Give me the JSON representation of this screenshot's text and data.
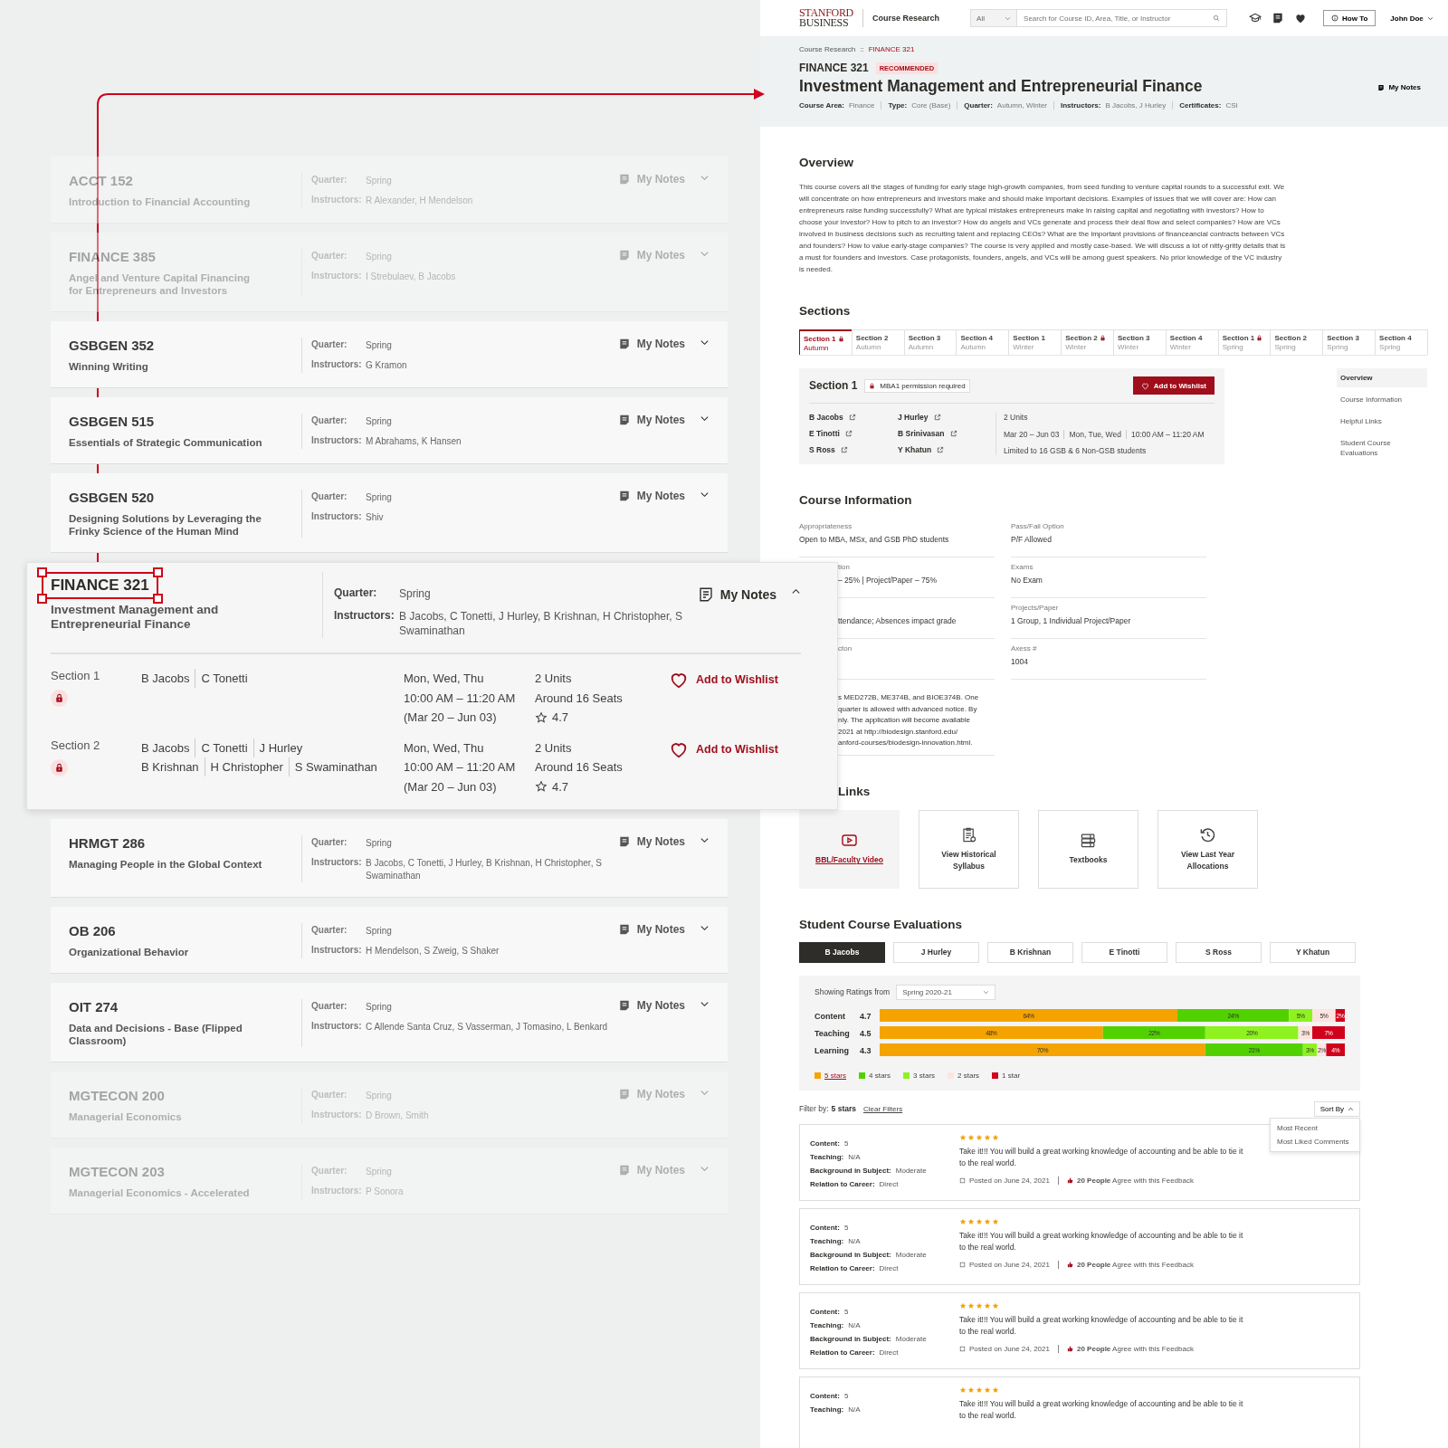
{
  "course_list": [
    {
      "code": "ACCT 152",
      "title": "Introduction to Financial Accounting",
      "quarter_label": "Quarter:",
      "quarter": "Spring",
      "instructors_label": "Instructors:",
      "instructors": "R Alexander, H Mendelson",
      "notes": "My Notes",
      "dimmed": true,
      "expanded": false
    },
    {
      "code": "FINANCE 385",
      "title": "Angel and Venture Capital Financing for Entrepreneurs and Investors",
      "quarter_label": "Quarter:",
      "quarter": "Spring",
      "instructors_label": "Instructors:",
      "instructors": "I Strebulaev, B Jacobs",
      "notes": "My Notes",
      "dimmed": true,
      "expanded": false
    },
    {
      "code": "GSBGEN 352",
      "title": "Winning Writing",
      "quarter_label": "Quarter:",
      "quarter": "Spring",
      "instructors_label": "Instructors:",
      "instructors": "G Kramon",
      "notes": "My Notes",
      "dimmed": false,
      "expanded": false
    },
    {
      "code": "GSBGEN 515",
      "title": "Essentials of Strategic Communication",
      "quarter_label": "Quarter:",
      "quarter": "Spring",
      "instructors_label": "Instructors:",
      "instructors": "M Abrahams, K Hansen",
      "notes": "My Notes",
      "dimmed": false,
      "expanded": false
    },
    {
      "code": "GSBGEN 520",
      "title": "Designing Solutions by Leveraging the Frinky Science of the Human Mind",
      "quarter_label": "Quarter:",
      "quarter": "Spring",
      "instructors_label": "Instructors:",
      "instructors": "Shiv",
      "notes": "My Notes",
      "dimmed": false,
      "expanded": false
    },
    {
      "code": "FINANCE 321",
      "title": "Investment Management and Entrepreneurial Finance",
      "quarter_label": "Quarter:",
      "quarter": "Spring",
      "instructors_label": "Instructors:",
      "instructors": "B Jacobs, C Tonetti, J Hurley, B Krishnan,  H Christopher, S Swaminathan",
      "notes": "My Notes",
      "dimmed": false,
      "expanded": true,
      "sections": [
        {
          "name": "Section 1",
          "locked": true,
          "instructor_lines": [
            [
              "B Jacobs",
              "C Tonetti"
            ]
          ],
          "schedule": [
            "Mon, Wed, Thu",
            "10:00 AM – 11:20 AM",
            "(Mar 20 – Jun 03)"
          ],
          "units": "2 Units",
          "seats": "Around 16 Seats",
          "rating": "4.7",
          "wishlist": "Add to Wishlist"
        },
        {
          "name": "Section 2",
          "locked": true,
          "instructor_lines": [
            [
              "B Jacobs",
              "C Tonetti",
              "J Hurley"
            ],
            [
              "B Krishnan",
              "H Christopher",
              "S Swaminathan"
            ]
          ],
          "schedule": [
            "Mon, Wed, Thu",
            "10:00 AM – 11:20 AM",
            "(Mar 20 – Jun 03)"
          ],
          "units": "2 Units",
          "seats": "Around 16 Seats",
          "rating": "4.7",
          "wishlist": "Add to Wishlist"
        }
      ]
    },
    {
      "code": "HRMGT 286",
      "title": "Managing People in the Global Context",
      "quarter_label": "Quarter:",
      "quarter": "Spring",
      "instructors_label": "Instructors:",
      "instructors": "B Jacobs, C Tonetti, J Hurley, B Krishnan,  H Christopher, S Swaminathan",
      "notes": "My Notes",
      "dimmed": false,
      "expanded": false
    },
    {
      "code": "OB 206",
      "title": "Organizational Behavior",
      "quarter_label": "Quarter:",
      "quarter": "Spring",
      "instructors_label": "Instructors:",
      "instructors": "H Mendelson, S Zweig, S Shaker",
      "notes": "My Notes",
      "dimmed": false,
      "expanded": false
    },
    {
      "code": "OIT 274",
      "title": "Data and Decisions - Base (Flipped Classroom)",
      "quarter_label": "Quarter:",
      "quarter": "Spring",
      "instructors_label": "Instructors:",
      "instructors": "C Allende Santa Cruz, S Vasserman, J Tomasino, L Benkard",
      "notes": "My Notes",
      "dimmed": false,
      "expanded": false
    },
    {
      "code": "MGTECON 200",
      "title": "Managerial Economics",
      "quarter_label": "Quarter:",
      "quarter": "Spring",
      "instructors_label": "Instructors:",
      "instructors": "D Brown, Smith",
      "notes": "My Notes",
      "dimmed": true,
      "expanded": false
    },
    {
      "code": "MGTECON 203",
      "title": "Managerial Economics - Accelerated",
      "quarter_label": "Quarter:",
      "quarter": "Spring",
      "instructors_label": "Instructors:",
      "instructors": "P Sonora",
      "notes": "My Notes",
      "dimmed": true,
      "expanded": false
    }
  ],
  "header": {
    "logo_top": "STANFORD",
    "logo_bottom": "BUSINESS",
    "app_name": "Course Research",
    "search_scope": "All",
    "search_placeholder": "Search for Course ID, Area, Title, or Instructor",
    "how_to": "How To",
    "user": "John Doe"
  },
  "breadcrumb": {
    "items": [
      {
        "label": "Course Research",
        "current": false
      },
      {
        "label": "FINANCE 321",
        "current": true
      }
    ],
    "separator": "::"
  },
  "course": {
    "code": "FINANCE 321",
    "badge": "RECOMMENDED",
    "title": "Investment Management and Entrepreneurial Finance",
    "notes": "My Notes",
    "meta": [
      {
        "label": "Course Area:",
        "value": "Finance"
      },
      {
        "label": "Type:",
        "value": "Core (Base)"
      },
      {
        "label": "Quarter:",
        "value": "Autumn, Winter"
      },
      {
        "label": "Instructors:",
        "value": "B Jacobs, J Hurley"
      },
      {
        "label": "Certificates:",
        "value": "CSI"
      }
    ]
  },
  "overview": {
    "heading": "Overview",
    "text": "This course covers all the stages of funding for early stage high-growth companies, from seed funding to venture capital rounds to a successful exit. We will concentrate on how entrepreneurs and investors make and should make important decisions. Examples of issues that we will cover are: How can entrepreneurs raise funding successfully? What are typical mistakes entrepreneurs make in raising capital and negotiating with investors? How to choose your investor? How to pitch to an investor? How do angels and VCs generate and process their deal flow and select companies? How are VCs involved in business decisions such as recruiting talent and replacing CEOs? What are the important provisions of financeancial contracts between VCs and founders? How to value early-stage companies? The course is very applied and mostly case-based. We will discuss a lot of nitty-gritty details that is a must for founders and investors. Case protagonists, founders, angels, and VCs will be among guest speakers. No prior knowledge of the VC industry is needed."
  },
  "sections": {
    "heading": "Sections",
    "tabs": [
      {
        "name": "Section 1",
        "quarter": "Autumn",
        "locked": true,
        "selected": true
      },
      {
        "name": "Section 2",
        "quarter": "Autumn",
        "locked": false,
        "selected": false
      },
      {
        "name": "Section 3",
        "quarter": "Autumn",
        "locked": false,
        "selected": false
      },
      {
        "name": "Section 4",
        "quarter": "Autumn",
        "locked": false,
        "selected": false
      },
      {
        "name": "Section 1",
        "quarter": "Winter",
        "locked": false,
        "selected": false
      },
      {
        "name": "Section 2",
        "quarter": "Winter",
        "locked": true,
        "selected": false
      },
      {
        "name": "Section 3",
        "quarter": "Winter",
        "locked": false,
        "selected": false
      },
      {
        "name": "Section 4",
        "quarter": "Winter",
        "locked": false,
        "selected": false
      },
      {
        "name": "Section 1",
        "quarter": "Spring",
        "locked": true,
        "selected": false
      },
      {
        "name": "Section 2",
        "quarter": "Spring",
        "locked": false,
        "selected": false
      },
      {
        "name": "Section 3",
        "quarter": "Spring",
        "locked": false,
        "selected": false
      },
      {
        "name": "Section 4",
        "quarter": "Spring",
        "locked": false,
        "selected": false
      }
    ],
    "detail": {
      "title": "Section 1",
      "permission": "MBA1 permission required",
      "wishlist": "Add to Wishlist",
      "instructors": [
        "B Jacobs",
        "J Hurley",
        "E Tinotti",
        "B Srinivasan",
        "S Ross",
        "Y Khatun"
      ],
      "units": "2 Units",
      "dates": "Mar 20 – Jun 03",
      "days": "Mon, Tue, Wed",
      "time": "10:00 AM – 11:20 AM",
      "limit": "Limited to 16 GSB & 6 Non-GSB students"
    }
  },
  "side_nav": [
    {
      "label": "Overview",
      "selected": true
    },
    {
      "label": "Course Information",
      "selected": false
    },
    {
      "label": "Helpful Links",
      "selected": false
    },
    {
      "label": "Student Course Evaluations",
      "selected": false
    }
  ],
  "course_information": {
    "heading": "Course Information",
    "fields": [
      {
        "label": "Appropriateness",
        "value": "Open to MBA, MSx, and GSB PhD students",
        "covered": false
      },
      {
        "label": "Pass/Fail Option",
        "value": "P/F Allowed",
        "covered": false
      },
      {
        "label": "tion",
        "value": "– 25% | Project/Paper – 75%",
        "covered": true
      },
      {
        "label": "Exams",
        "value": "No Exam",
        "covered": false
      },
      {
        "value": "ttendance; Absences impact grade",
        "covered": true
      },
      {
        "label": "Projects/Paper",
        "value": "1 Group, 1 Individual Project/Paper",
        "covered": false
      },
      {
        "label": "cton",
        "covered": true
      },
      {
        "label": "Axess #",
        "value": "1004",
        "covered": false
      },
      {
        "lines": [
          "s MED272B, ME374B, and BIOE374B. One",
          "quarter is allowed with advanced notice. By",
          "nly. The application will become available",
          "2021 at http://biodesign.stanford.edu/",
          "anford-courses/biodesign-innovation.html."
        ],
        "covered": true
      }
    ]
  },
  "helpful_links": {
    "heading": "Links",
    "heading_covered": true,
    "items": [
      {
        "label": "BBL/Faculty Video",
        "kind": "video",
        "highlighted": true
      },
      {
        "label": "View Historical Syllabus",
        "kind": "syllabus",
        "highlighted": false
      },
      {
        "label": "Textbooks",
        "kind": "textbooks",
        "highlighted": false
      },
      {
        "label": "View Last Year Allocations",
        "kind": "history",
        "highlighted": false
      }
    ]
  },
  "evaluations": {
    "heading": "Student Course Evaluations",
    "instructors": [
      {
        "name": "B Jacobs",
        "selected": true
      },
      {
        "name": "J Hurley",
        "selected": false
      },
      {
        "name": "B Krishnan",
        "selected": false
      },
      {
        "name": "E Tinotti",
        "selected": false
      },
      {
        "name": "S Ross",
        "selected": false
      },
      {
        "name": "Y Khatun",
        "selected": false
      }
    ],
    "ratings": {
      "showing_label": "Showing Ratings from",
      "term": "Spring 2020-21",
      "scores": [
        "4.7",
        "4.5",
        "4.3"
      ],
      "legend_selected": [
        true,
        false,
        false,
        false,
        false
      ],
      "chart_data": {
        "type": "bar",
        "orientation": "horizontal",
        "stacked": true,
        "categories": [
          "Content",
          "Teaching",
          "Learning"
        ],
        "series": [
          {
            "name": "5 stars",
            "color": "#f5a300",
            "values": [
              64,
              48,
              70
            ],
            "value_labels": [
              "64%",
              "48%",
              "70%"
            ]
          },
          {
            "name": "4 stars",
            "color": "#52d100",
            "values": [
              24,
              22,
              21
            ],
            "value_labels": [
              "24%",
              "22%",
              "21%"
            ]
          },
          {
            "name": "3 stars",
            "color": "#8ef21f",
            "values": [
              5,
              20,
              3
            ],
            "value_labels": [
              "5%",
              "20%",
              "3%"
            ]
          },
          {
            "name": "2 stars",
            "color": "#fde4e0",
            "values": [
              5,
              3,
              2
            ],
            "value_labels": [
              "5%",
              "3%",
              "2%"
            ]
          },
          {
            "name": "1 star",
            "color": "#d0021b",
            "values": [
              2,
              7,
              4
            ],
            "value_labels": [
              "2%",
              "7%",
              "4%"
            ]
          }
        ]
      }
    },
    "filter": {
      "label": "Filter by:",
      "value": "5 stars",
      "clear": "Clear Filters"
    },
    "sort": {
      "label": "Sort By",
      "expanded": true,
      "options": [
        "Most Recent",
        "Most Liked Comments"
      ]
    },
    "reviews": [
      {
        "fields": [
          {
            "label": "Content:",
            "value": "5"
          },
          {
            "label": "Teaching:",
            "value": "N/A"
          },
          {
            "label": "Background in Subject:",
            "value": "Moderate"
          },
          {
            "label": "Relation to Career:",
            "value": "Direct"
          }
        ],
        "stars": 5,
        "text": "Take it!!! You will build a great working knowledge of accounting and be able to tie it to the real world.",
        "posted": "Posted on June 24, 2021",
        "agree": "**20 People** Agree with this Feedback"
      },
      {
        "fields": [
          {
            "label": "Content:",
            "value": "5"
          },
          {
            "label": "Teaching:",
            "value": "N/A"
          },
          {
            "label": "Background in Subject:",
            "value": "Moderate"
          },
          {
            "label": "Relation to Career:",
            "value": "Direct"
          }
        ],
        "stars": 5,
        "text": "Take it!!! You will build a great working knowledge of accounting and be able to tie it to the real world.",
        "posted": "Posted on June 24, 2021",
        "agree": "**20 People** Agree with this Feedback"
      },
      {
        "fields": [
          {
            "label": "Content:",
            "value": "5"
          },
          {
            "label": "Teaching:",
            "value": "N/A"
          },
          {
            "label": "Background in Subject:",
            "value": "Moderate"
          },
          {
            "label": "Relation to Career:",
            "value": "Direct"
          }
        ],
        "stars": 5,
        "text": "Take it!!! You will build a great working knowledge of accounting and be able to tie it to the real world.",
        "posted": "Posted on June 24, 2021",
        "agree": "**20 People** Agree with this Feedback"
      },
      {
        "fields": [
          {
            "label": "Content:",
            "value": "5"
          },
          {
            "label": "Teaching:",
            "value": "N/A"
          }
        ],
        "stars": 5,
        "text": "Take it!!! You will build a great working knowledge of accounting and be able to tie it to the real world."
      }
    ]
  }
}
